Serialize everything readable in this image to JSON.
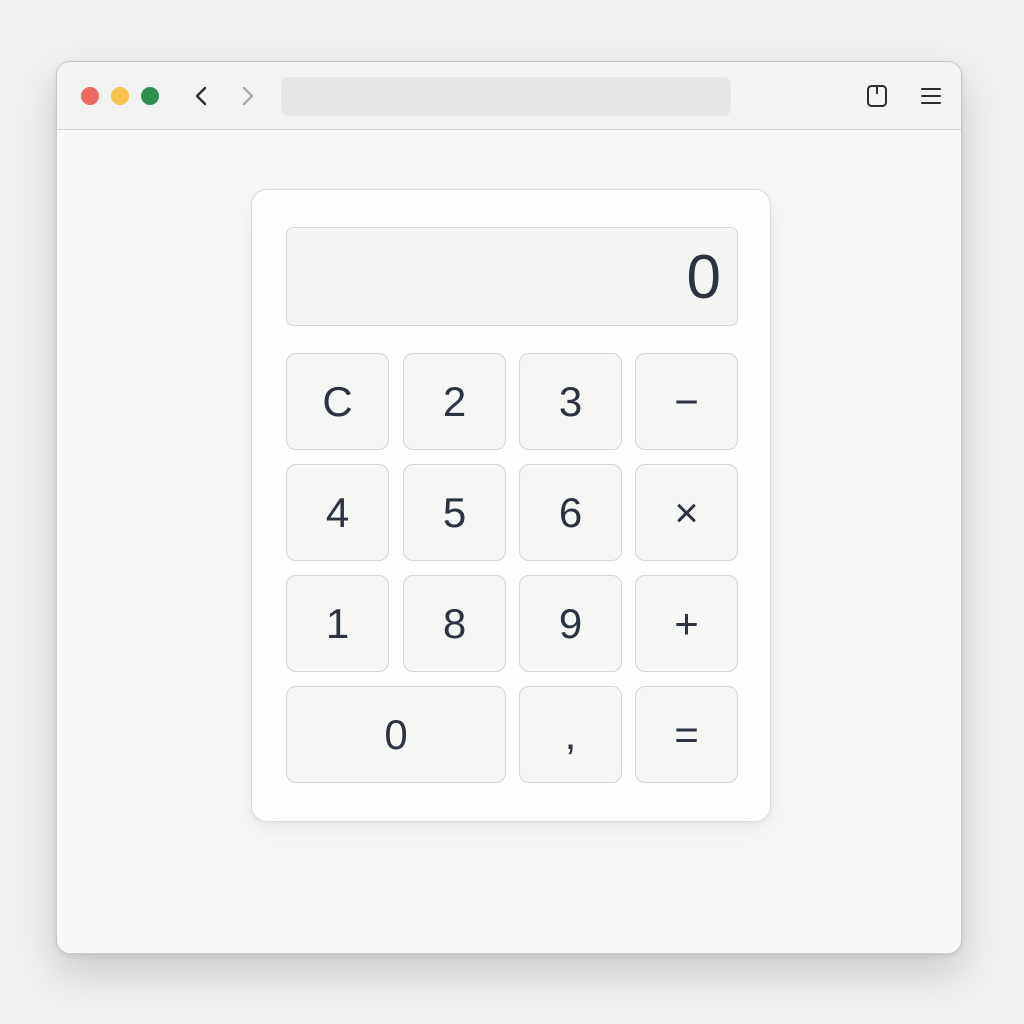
{
  "browser": {
    "address_bar": {
      "value": "",
      "placeholder": ""
    },
    "icons": {
      "back": "chevron-left-icon",
      "forward": "chevron-right-icon",
      "extension": "extension-icon",
      "menu": "hamburger-menu-icon"
    },
    "traffic_lights": {
      "close": "#ee6a5f",
      "minimize": "#f5c44f",
      "zoom": "#2e8f4f"
    }
  },
  "calculator": {
    "display": "0",
    "keys": {
      "clear": "C",
      "two": "2",
      "three": "3",
      "minus": "−",
      "four": "4",
      "five": "5",
      "six": "6",
      "multiply": "×",
      "one": "1",
      "eight": "8",
      "nine": "9",
      "plus": "+",
      "zero": "0",
      "decimal": ",",
      "equals": "="
    }
  },
  "colors": {
    "text": "#2c3340",
    "key_background": "#f6f6f5",
    "page_background": "#f9f8f7"
  }
}
